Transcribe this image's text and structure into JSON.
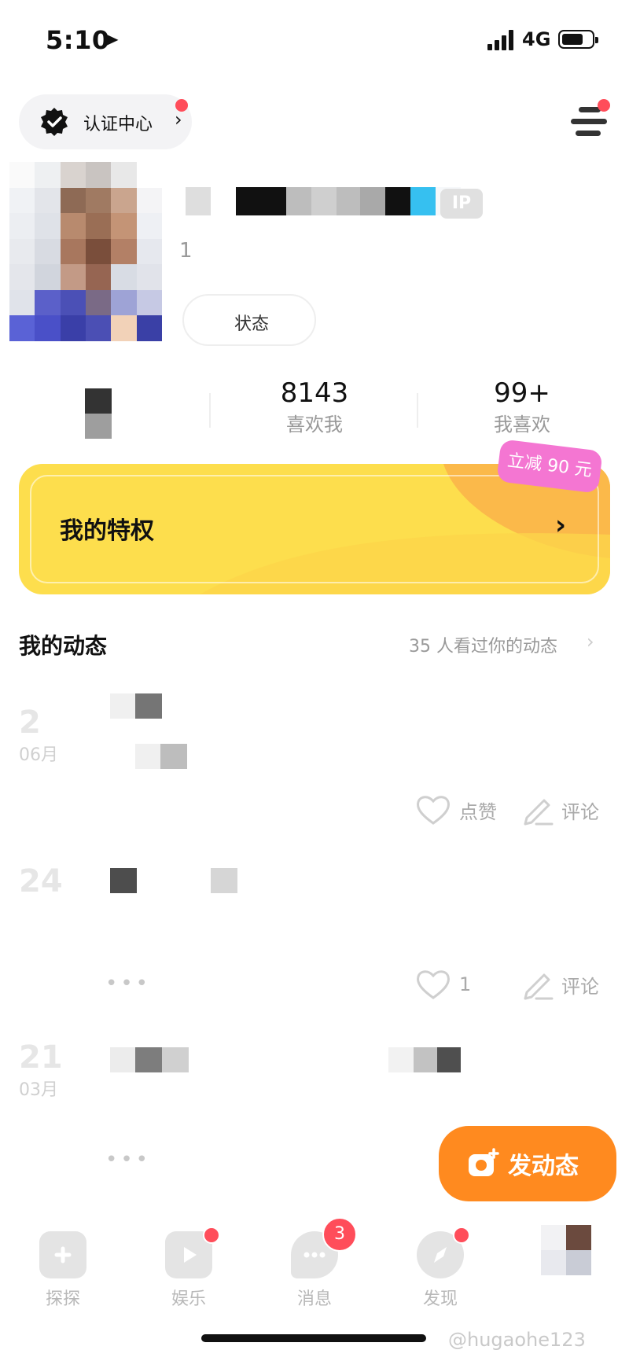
{
  "status_bar": {
    "time": "5:10",
    "network": "4G"
  },
  "header": {
    "cert_label": "认证中心"
  },
  "profile": {
    "ip_badge": "IP",
    "sub_number": "1",
    "status_label": "状态"
  },
  "stats": [
    {
      "value": "8143",
      "label": "喜欢我"
    },
    {
      "value": "99+",
      "label": "我喜欢"
    }
  ],
  "privilege": {
    "title": "我的特权",
    "promo": "立减 90 元"
  },
  "moments": {
    "title": "我的动态",
    "views": "35 人看过你的动态",
    "posts": [
      {
        "day": "2",
        "month": "06月",
        "like_label": "点赞",
        "comment_label": "评论"
      },
      {
        "day": "24",
        "month": "",
        "like_label": "1",
        "comment_label": "评论"
      },
      {
        "day": "21",
        "month": "03月",
        "like_label": "",
        "comment_label": ""
      }
    ]
  },
  "post_button": {
    "label": "发动态"
  },
  "tabbar": [
    {
      "label": "探探",
      "icon": "cards-icon"
    },
    {
      "label": "娱乐",
      "icon": "play-icon"
    },
    {
      "label": "消息",
      "icon": "chat-icon",
      "badge": "3"
    },
    {
      "label": "发现",
      "icon": "compass-icon"
    }
  ],
  "watermark": "@hugaohe123",
  "colors": {
    "accent_orange": "#ff8a1f",
    "banner_yellow": "#fdde4d",
    "promo_pink": "#f476d2",
    "badge_red": "#ff4d5a"
  }
}
